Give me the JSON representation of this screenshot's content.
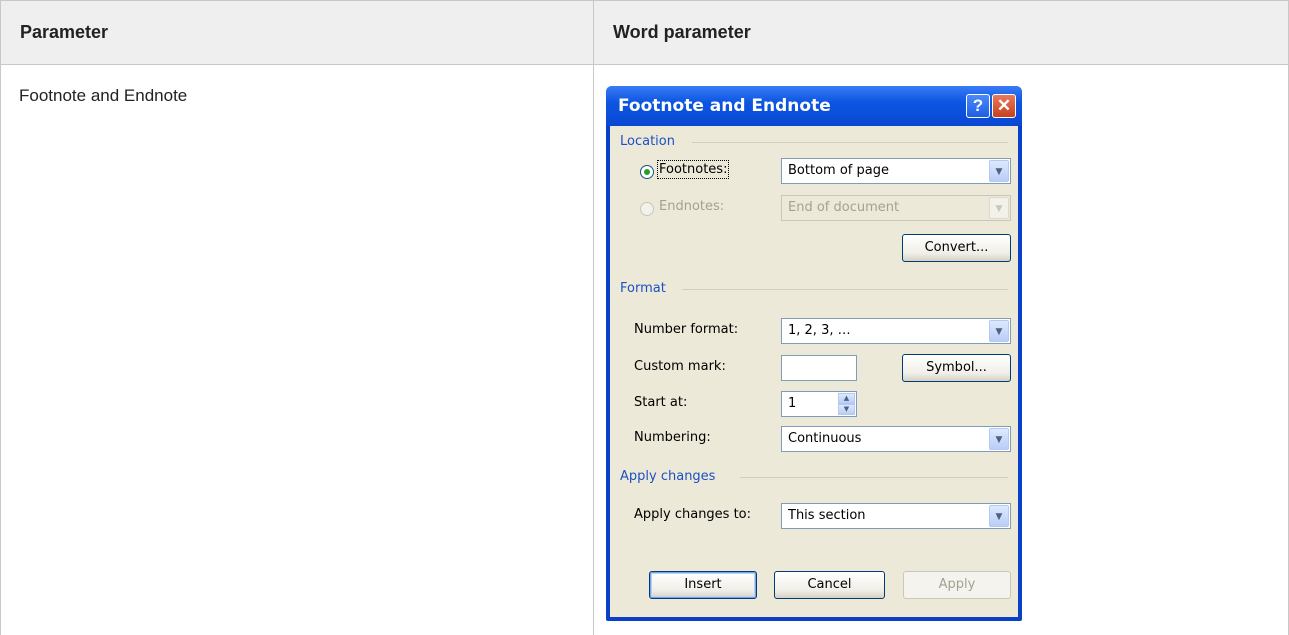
{
  "table": {
    "header_left": "Parameter",
    "header_right": "Word parameter",
    "row1_left": "Footnote and Endnote"
  },
  "dialog": {
    "title": "Footnote and Endnote",
    "help_icon": "?",
    "close_icon": "✕",
    "location_group": "Location",
    "footnotes_label": "Footnotes:",
    "footnotes_value": "Bottom of page",
    "endnotes_label": "Endnotes:",
    "endnotes_value": "End of document",
    "convert_label": "Convert...",
    "format_group": "Format",
    "number_format_label": "Number format:",
    "number_format_value": "1, 2, 3, …",
    "custom_mark_label": "Custom mark:",
    "custom_mark_value": "",
    "symbol_label": "Symbol...",
    "start_at_label": "Start at:",
    "start_at_value": "1",
    "numbering_label": "Numbering:",
    "numbering_value": "Continuous",
    "apply_group": "Apply changes",
    "apply_to_label": "Apply changes to:",
    "apply_to_value": "This section",
    "insert_label": "Insert",
    "cancel_label": "Cancel",
    "apply_label": "Apply",
    "dropdown_icon": "▼",
    "spin_up_icon": "▲",
    "spin_down_icon": "▼"
  },
  "colors": {
    "titlebar": "#0d56e2",
    "dialog_face": "#ece9d8",
    "group_label": "#1d4fc6",
    "table_header_bg": "#efefef"
  }
}
